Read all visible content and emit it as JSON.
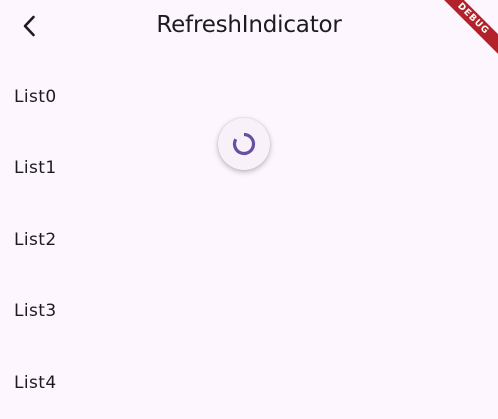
{
  "app_bar": {
    "title": "RefreshIndicator",
    "back_icon": "arrow-back-icon"
  },
  "list": {
    "items": [
      "List0",
      "List1",
      "List2",
      "List3",
      "List4"
    ]
  },
  "refresh_indicator": {
    "state": "refreshing",
    "color": "#6750a4"
  },
  "debug_banner": {
    "label": "DEBUG",
    "color": "#b3222a"
  },
  "colors": {
    "background": "#fdf6fe",
    "text": "#1d1b20"
  }
}
